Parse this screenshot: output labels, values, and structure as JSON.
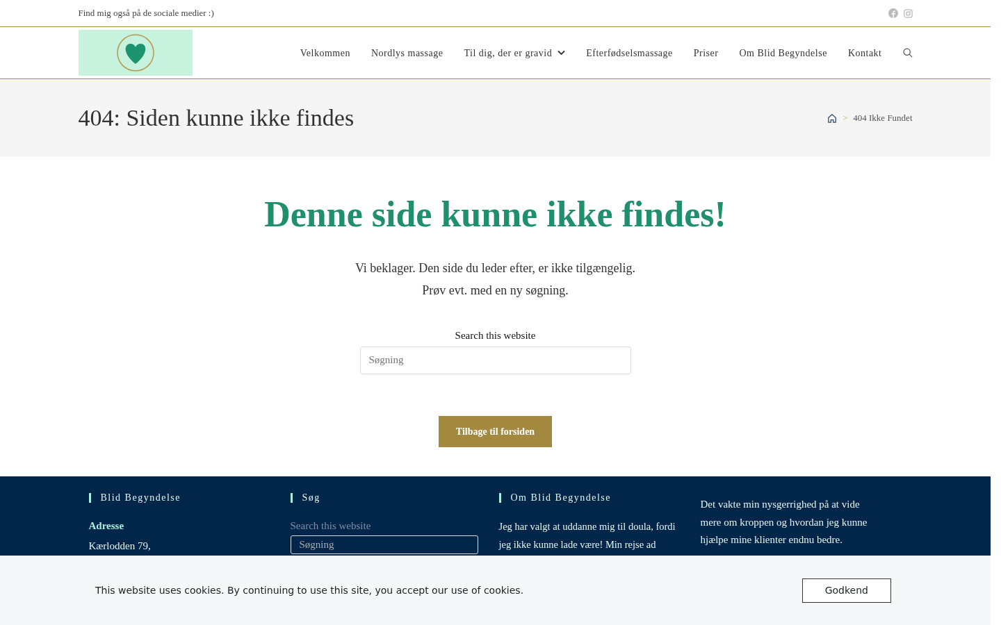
{
  "topbar": {
    "text": "Find mig også på de sociale medier :)",
    "social": [
      {
        "kind": "facebook"
      },
      {
        "kind": "instagram"
      }
    ]
  },
  "nav": {
    "items": [
      {
        "label": "Velkommen",
        "dropdown": false
      },
      {
        "label": "Nordlys massage",
        "dropdown": false
      },
      {
        "label": "Til dig, der er gravid",
        "dropdown": true
      },
      {
        "label": "Efterfødselsmassage",
        "dropdown": false
      },
      {
        "label": "Priser",
        "dropdown": false
      },
      {
        "label": "Om Blid Begyndelse",
        "dropdown": false
      },
      {
        "label": "Kontakt",
        "dropdown": false
      }
    ]
  },
  "page_header": {
    "title": "404: Siden kunne ikke findes",
    "breadcrumb": {
      "separator": ">",
      "current": "404 Ikke Fundet"
    }
  },
  "content": {
    "heading": "Denne side kunne ikke findes!",
    "lines": [
      "Vi beklager. Den side du leder efter, er ikke tilgængelig.",
      "Prøv evt. med en ny søgning."
    ],
    "search": {
      "label": "Search this website",
      "placeholder": "Søgning"
    },
    "button": "Tilbage til forsiden"
  },
  "footer": {
    "columns": [
      {
        "title": "Blid Begyndelse",
        "label": "Adresse",
        "lines": [
          "Kærlodden 79,"
        ]
      },
      {
        "title": "Søg",
        "search_label": "Search this website",
        "placeholder": "Søgning"
      },
      {
        "title": "Om Blid Begyndelse",
        "text_lines": [
          "Jeg har valgt at uddanne mig til doula, fordi",
          "jeg ikke kunne lade være! Min rejse ad"
        ]
      },
      {
        "text": "Det vakte min nysgerrighed på at vide mere om kroppen og hvordan jeg kunne hjælpe mine klienter endnu bedre."
      }
    ]
  },
  "cookie_bar": {
    "text": "This website uses cookies. By continuing to use this site, you accept our use of cookies.",
    "button": "Godkend"
  }
}
